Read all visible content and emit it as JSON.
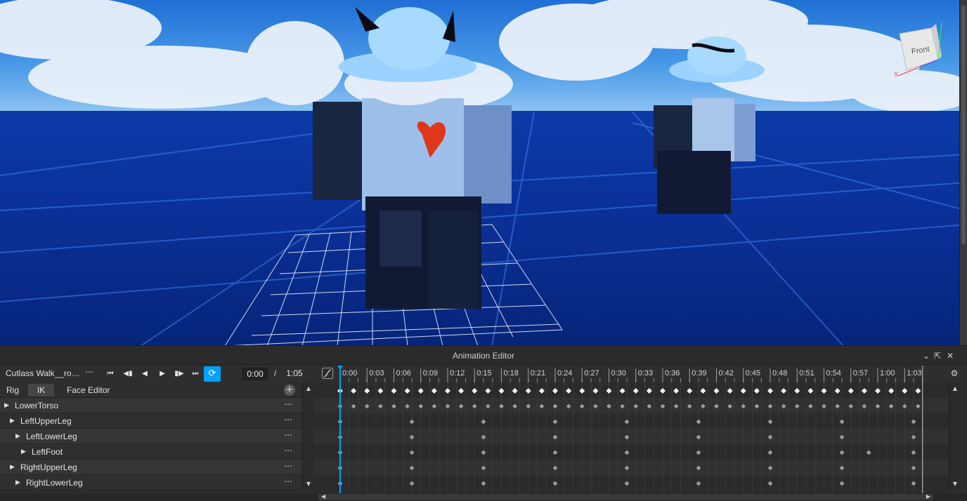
{
  "viewport": {
    "floating_label": "f",
    "view_cube": {
      "face": "Front",
      "axis_x": "X"
    }
  },
  "editor": {
    "title": "Animation Editor",
    "animation_name": "Cutlass Walk__ro…",
    "time_current": "0:00",
    "time_separator": "/",
    "time_end": "1:05",
    "rig_label": "Rig",
    "tabs": [
      "IK",
      "Face Editor"
    ],
    "tracks": [
      {
        "name": "LowerTorso",
        "indent": 0
      },
      {
        "name": "LeftUpperLeg",
        "indent": 1
      },
      {
        "name": "LeftLowerLeg",
        "indent": 2
      },
      {
        "name": "LeftFoot",
        "indent": 3
      },
      {
        "name": "RightUpperLeg",
        "indent": 1
      },
      {
        "name": "RightLowerLeg",
        "indent": 2
      }
    ],
    "ticks": [
      "0:00",
      "0:03",
      "0:06",
      "0:09",
      "0:12",
      "0:15",
      "0:18",
      "0:21",
      "0:24",
      "0:27",
      "0:30",
      "0:33",
      "0:36",
      "0:39",
      "0:42",
      "0:45",
      "0:48",
      "0:51",
      "0:54",
      "0:57",
      "1:00",
      "1:03"
    ],
    "timeline": {
      "total_frames": 65,
      "dense_step": 1.5,
      "sparse_frames": [
        0,
        8,
        16,
        24,
        32,
        40,
        48,
        56,
        64
      ],
      "leftfoot_extra_frame": 59
    }
  }
}
